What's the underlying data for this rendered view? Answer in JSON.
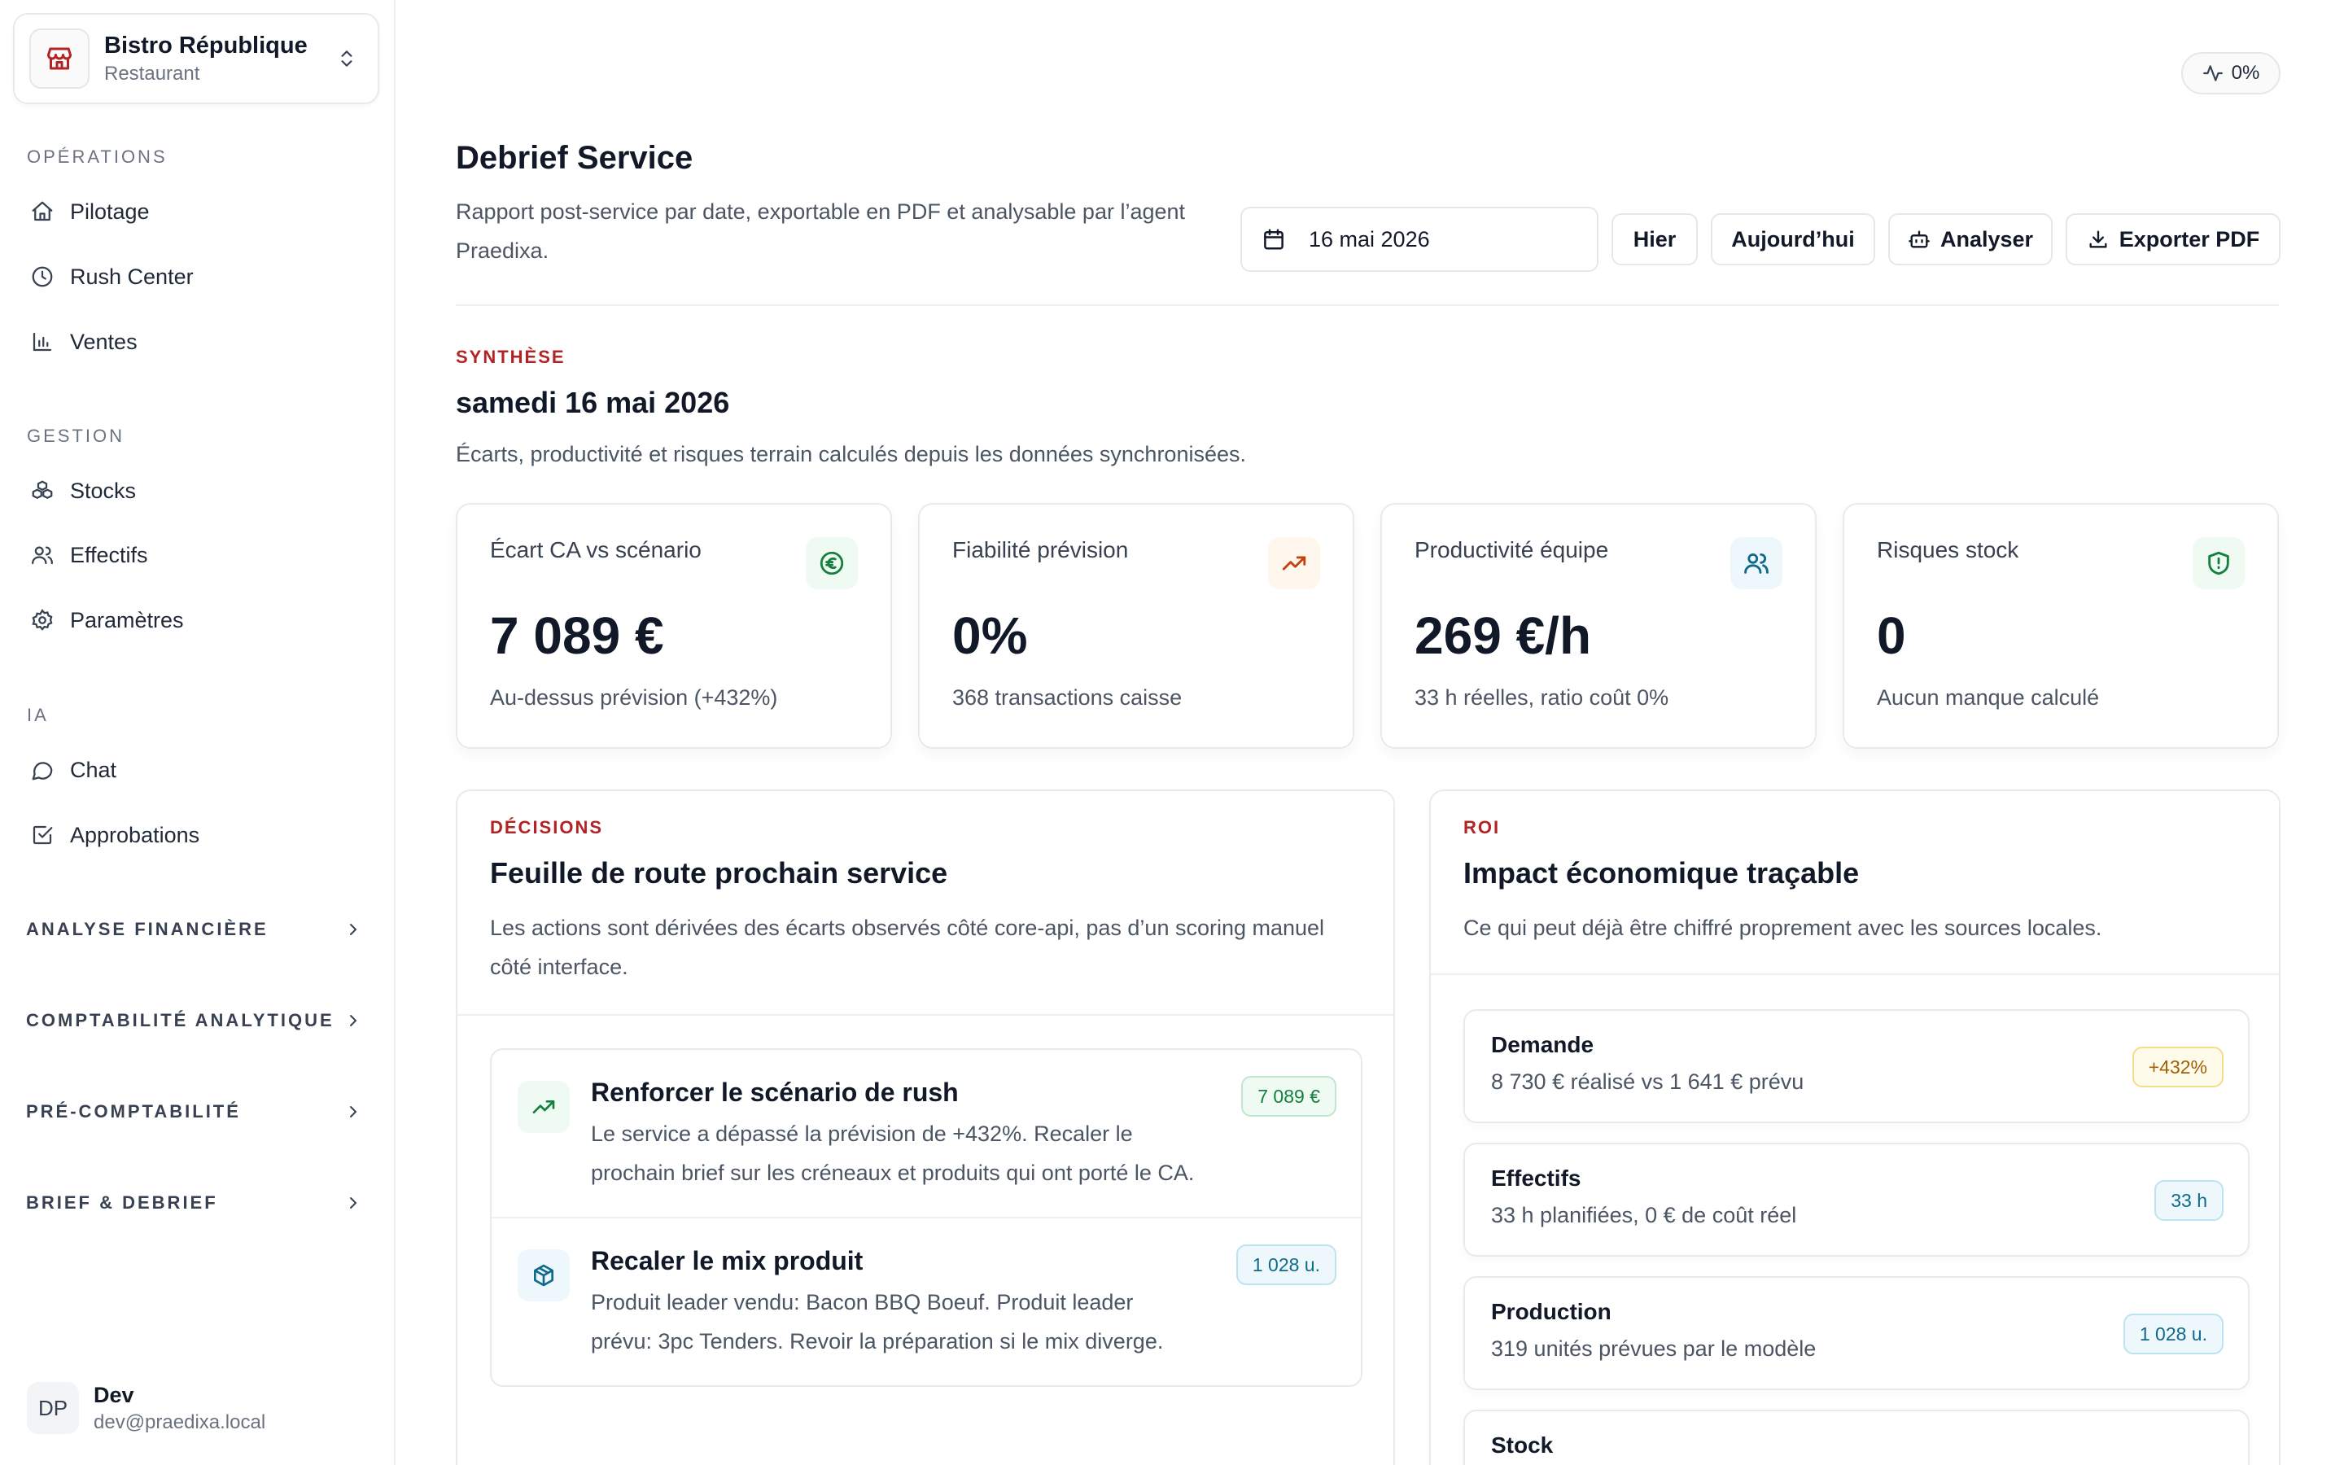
{
  "org": {
    "name": "Bistro République",
    "type": "Restaurant"
  },
  "nav": {
    "sections": [
      {
        "title": "OPÉRATIONS",
        "items": [
          "Pilotage",
          "Rush Center",
          "Ventes"
        ]
      },
      {
        "title": "GESTION",
        "items": [
          "Stocks",
          "Effectifs",
          "Paramètres"
        ]
      },
      {
        "title": "IA",
        "items": [
          "Chat",
          "Approbations"
        ]
      }
    ],
    "groups": [
      "ANALYSE FINANCIÈRE",
      "COMPTABILITÉ ANALYTIQUE",
      "PRÉ-COMPTABILITÉ",
      "BRIEF & DEBRIEF"
    ]
  },
  "user": {
    "initials": "DP",
    "name": "Dev",
    "email": "dev@praedixa.local"
  },
  "status_pill": "0%",
  "header": {
    "title": "Debrief Service",
    "subtitle": "Rapport post-service par date, exportable en PDF et analysable par l’agent Praedixa.",
    "date_value": "16 mai 2026",
    "buttons": {
      "yesterday": "Hier",
      "today": "Aujourd’hui",
      "analyze": "Analyser",
      "export": "Exporter PDF"
    }
  },
  "synthese": {
    "kicker": "SYNTHÈSE",
    "title": "samedi 16 mai 2026",
    "subtitle": "Écarts, productivité et risques terrain calculés depuis les données synchronisées."
  },
  "kpis": [
    {
      "label": "Écart CA vs scénario",
      "value": "7 089 €",
      "note": "Au-dessus prévision (+432%)",
      "icon": "euro-icon",
      "color": "#15803d"
    },
    {
      "label": "Fiabilité prévision",
      "value": "0%",
      "note": "368 transactions caisse",
      "icon": "trending-up-icon",
      "color": "#c2410c"
    },
    {
      "label": "Productivité équipe",
      "value": "269 €/h",
      "note": "33 h réelles, ratio coût 0%",
      "icon": "users-icon",
      "color": "#0e6a8a"
    },
    {
      "label": "Risques stock",
      "value": "0",
      "note": "Aucun manque calculé",
      "icon": "shield-icon",
      "color": "#15803d"
    }
  ],
  "decisions": {
    "kicker": "DÉCISIONS",
    "title": "Feuille de route prochain service",
    "subtitle": "Les actions sont dérivées des écarts observés côté core-api, pas d’un scoring manuel côté interface.",
    "items": [
      {
        "title": "Renforcer le scénario de rush",
        "desc": "Le service a dépassé la prévision de +432%. Recaler le prochain brief sur les créneaux et produits qui ont porté le CA.",
        "badge": "7 089 €",
        "icon": "trending-up-icon"
      },
      {
        "title": "Recaler le mix produit",
        "desc": "Produit leader vendu: Bacon BBQ Boeuf. Produit leader prévu: 3pc Tenders. Revoir la préparation si le mix diverge.",
        "badge": "1 028 u.",
        "icon": "package-icon"
      }
    ]
  },
  "roi": {
    "kicker": "ROI",
    "title": "Impact économique traçable",
    "subtitle": "Ce qui peut déjà être chiffré proprement avec les sources locales.",
    "items": [
      {
        "title": "Demande",
        "desc": "8 730 € réalisé vs 1 641 € prévu",
        "badge": "+432%"
      },
      {
        "title": "Effectifs",
        "desc": "33 h planifiées, 0 € de coût réel",
        "badge": "33 h"
      },
      {
        "title": "Production",
        "desc": "319 unités prévues par le modèle",
        "badge": "1 028 u."
      },
      {
        "title": "Stock",
        "desc": "",
        "badge": ""
      }
    ]
  },
  "colors": {
    "accent_red": "#b42323",
    "green": "#15803d",
    "blue": "#0e6a8a",
    "amber": "#a16207"
  }
}
